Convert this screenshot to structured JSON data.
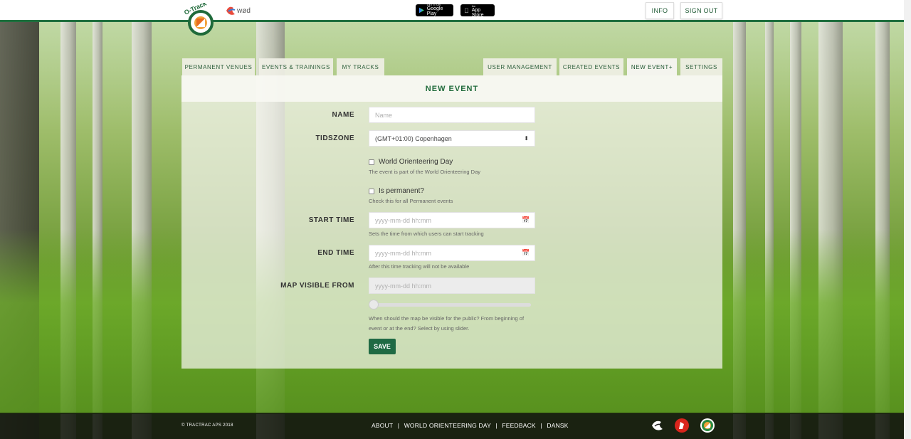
{
  "header": {
    "google_play": {
      "small": "GET IT ON",
      "big": "Google Play"
    },
    "app_store": {
      "small": "Download on the",
      "big": "App Store"
    },
    "info_label": "INFO",
    "signout_label": "SIGN OUT"
  },
  "tabs_left": [
    "PERMANENT VENUES",
    "EVENTS & TRAININGS",
    "MY TRACKS"
  ],
  "tabs_right": [
    "USER MANAGEMENT",
    "CREATED EVENTS",
    "NEW EVENT+",
    "SETTINGS"
  ],
  "form": {
    "title": "NEW EVENT",
    "name_label": "NAME",
    "name_placeholder": "Name",
    "tz_label": "TIDSZONE",
    "tz_value": "(GMT+01:00) Copenhagen",
    "wod_label": "World Orienteering Day",
    "wod_help": "The event is part of the World Orienteering Day",
    "perm_label": "Is permanent?",
    "perm_help": "Check this for all Permanent events",
    "start_label": "START TIME",
    "start_placeholder": "yyyy-mm-dd hh:mm",
    "start_help": "Sets the time from which users can start tracking",
    "end_label": "END TIME",
    "end_placeholder": "yyyy-mm-dd hh:mm",
    "end_help": "After this time tracking will not be available",
    "map_label": "MAP VISIBLE FROM",
    "map_placeholder": "yyyy-mm-dd hh:mm",
    "map_help_1": "When should the map be visible for the public? From beginning of",
    "map_help_2": "event or at the end? Select by using slider.",
    "slider_value": 0,
    "save_label": "SAVE"
  },
  "footer": {
    "copyright": "© TRACTRAC APS 2018",
    "about": "ABOUT",
    "wod": "WORLD ORIENTEERING DAY",
    "feedback": "FEEDBACK",
    "lang": "DANSK",
    "sep": "|"
  },
  "colors": {
    "brand_green": "#1f6a44",
    "header_border": "#1f6f3e",
    "tab_text": "#2c5e3b"
  }
}
